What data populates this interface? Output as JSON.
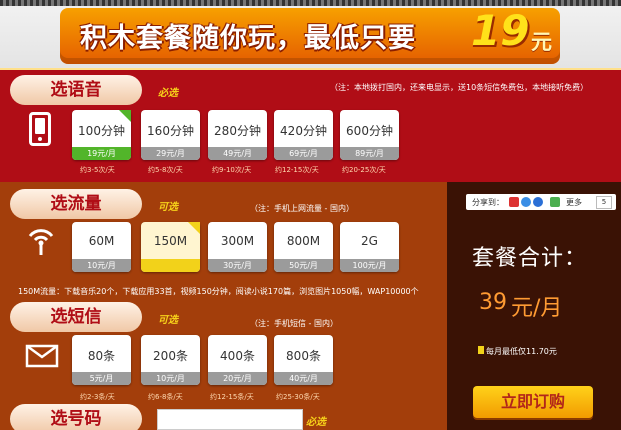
{
  "banner": {
    "title": "积木套餐随你玩，最低只要",
    "price": "19",
    "price_unit": "元"
  },
  "voice": {
    "tab": "选语音",
    "required": "必选",
    "note": "（注：本地拨打国内，还来电显示，送10条短信免费包，本地接听免费）",
    "options": [
      {
        "label": "100分钟",
        "price": "19元/月",
        "sub": "约3-5次/天",
        "selected": true
      },
      {
        "label": "160分钟",
        "price": "29元/月",
        "sub": "约5-8次/天",
        "selected": false
      },
      {
        "label": "280分钟",
        "price": "49元/月",
        "sub": "约9-10次/天",
        "selected": false
      },
      {
        "label": "420分钟",
        "price": "69元/月",
        "sub": "约12-15次/天",
        "selected": false
      },
      {
        "label": "600分钟",
        "price": "89元/月",
        "sub": "约20-25次/天",
        "selected": false
      }
    ]
  },
  "data": {
    "tab": "选流量",
    "required": "可选",
    "note": "（注：手机上网流量 - 国内）",
    "options": [
      {
        "label": "60M",
        "price": "10元/月",
        "selected": false
      },
      {
        "label": "150M",
        "price": "",
        "selected": true
      },
      {
        "label": "300M",
        "price": "30元/月",
        "selected": false
      },
      {
        "label": "800M",
        "price": "50元/月",
        "selected": false
      },
      {
        "label": "2G",
        "price": "100元/月",
        "selected": false
      }
    ],
    "caption": "150M流量：下载音乐20个，下载应用33首，视频150分钟，阅读小说170篇，浏览图片1050幅，WAP10000个"
  },
  "sms": {
    "tab": "选短信",
    "required": "可选",
    "note": "（注：手机短信 - 国内）",
    "options": [
      {
        "label": "80条",
        "price": "5元/月",
        "sub": "约2-3条/天"
      },
      {
        "label": "200条",
        "price": "10元/月",
        "sub": "约6-8条/天"
      },
      {
        "label": "400条",
        "price": "20元/月",
        "sub": "约12-15条/天"
      },
      {
        "label": "800条",
        "price": "40元/月",
        "sub": "约25-30条/天"
      }
    ]
  },
  "number": {
    "tab": "选号码",
    "required": "必选",
    "input_value": ""
  },
  "share": {
    "label": "分享到：",
    "more": "更多",
    "count": "5"
  },
  "summary": {
    "title": "套餐合计：",
    "value": "39",
    "unit": "元/月",
    "avg": "每月最低仅11.70元",
    "buy": "立即订购"
  },
  "colors": {
    "red_panel": "#b00d16",
    "brown_panel": "#a33e0b",
    "dark_panel": "#3a1205",
    "selected_green": "#52b52a",
    "selected_yellow": "#f2d21a",
    "accent_orange": "#ff9b33"
  }
}
